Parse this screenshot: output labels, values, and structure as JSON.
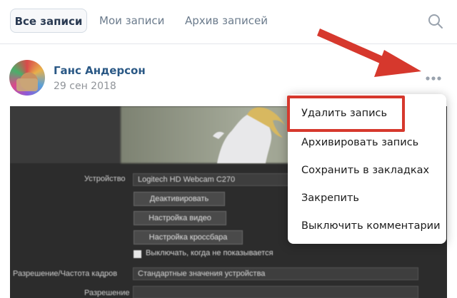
{
  "tabs": {
    "all_posts": "Все записи",
    "my_posts": "Мои записи",
    "archive": "Архив записей"
  },
  "post": {
    "author": "Ганс Андерсон",
    "date": "29 сен 2018"
  },
  "screenshot": {
    "device_label": "Устройство",
    "device_value": "Logitech HD Webcam C270",
    "deactivate_label": "Деактивировать",
    "video_settings_label": "Настройка видео",
    "crossbar_settings_label": "Настройка кроссбара",
    "checkbox_label": "Выключать, когда не показывается",
    "resolution_label": "Разрешение/Частота кадров",
    "resolution_value": "Стандартные значения устройства",
    "next_label": "Разрешение"
  },
  "menu": {
    "items": [
      "Удалить запись",
      "Архивировать запись",
      "Сохранить в закладках",
      "Закрепить",
      "Выключить комментарии"
    ]
  },
  "colors": {
    "accent": "#2a5885",
    "annotation_red": "#d6382d"
  }
}
